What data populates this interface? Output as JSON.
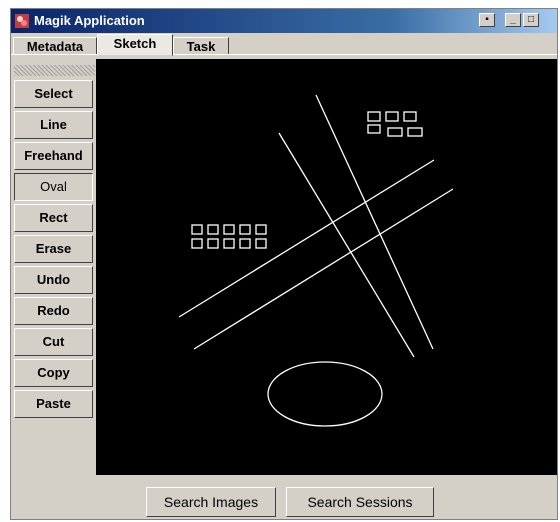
{
  "window": {
    "title": "Magik Application",
    "controls": [
      "restore",
      "minimize",
      "maximize"
    ]
  },
  "tabs": [
    {
      "label": "Metadata",
      "active": false
    },
    {
      "label": "Sketch",
      "active": true
    },
    {
      "label": "Task",
      "active": false
    }
  ],
  "toolbar": {
    "selected_tool": "Oval",
    "items": [
      {
        "label": "Select"
      },
      {
        "label": "Line"
      },
      {
        "label": "Freehand"
      },
      {
        "label": "Oval"
      },
      {
        "label": "Rect"
      },
      {
        "label": "Erase"
      },
      {
        "label": "Undo"
      },
      {
        "label": "Redo"
      },
      {
        "label": "Cut"
      },
      {
        "label": "Copy"
      },
      {
        "label": "Paste"
      }
    ]
  },
  "canvas": {
    "background": "#000000",
    "stroke": "#ffffff"
  },
  "bottom": {
    "search_images_label": "Search Images",
    "search_sessions_label": "Search Sessions"
  }
}
